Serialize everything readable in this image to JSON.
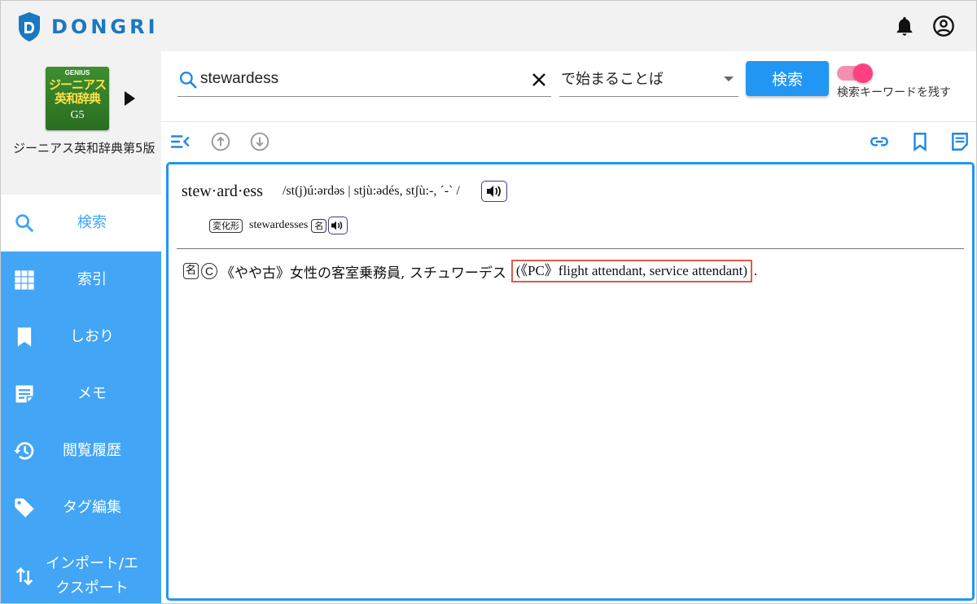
{
  "app": {
    "logo_text": "DONGRI"
  },
  "sidebar": {
    "book": {
      "cover_brand": "GENIUS",
      "cover_title": "ジーニアス英和辞典",
      "cover_edition": "G5",
      "name": "ジーニアス英和辞典第5版"
    },
    "items": [
      {
        "label": "検索",
        "icon": "search-icon"
      },
      {
        "label": "索引",
        "icon": "grid-icon"
      },
      {
        "label": "しおり",
        "icon": "bookmark-icon"
      },
      {
        "label": "メモ",
        "icon": "note-icon"
      },
      {
        "label": "閲覧履歴",
        "icon": "history-icon"
      },
      {
        "label": "タグ編集",
        "icon": "tag-icon"
      },
      {
        "label": "インポート/エクスポート",
        "icon": "import-export-icon"
      }
    ]
  },
  "search": {
    "query": "stewardess",
    "mode": "で始まることば",
    "button_label": "検索",
    "keep_keyword_label": "検索キーワードを残す",
    "keep_keyword_on": true
  },
  "entry": {
    "headword": "stew·ard·ess",
    "pronunciation": "/st(j)ú:ərdəs | stjù:ədés, stʃù:-, ˊ-ˋ /",
    "inflection_tag": "変化形",
    "inflection_word": "stewardesses",
    "pos_tag": "名",
    "countable_mark": "C",
    "definition": "《やや古》女性の客室乗務員, スチュワーデス",
    "highlighted_note": "(《PC》flight attendant, service attendant)",
    "definition_end": "."
  },
  "colors": {
    "accent": "#2196f3",
    "sidebar": "#42a5f5",
    "logo": "#1a78c2",
    "toggle": "#ff4081",
    "highlight_border": "#e05a4f"
  }
}
